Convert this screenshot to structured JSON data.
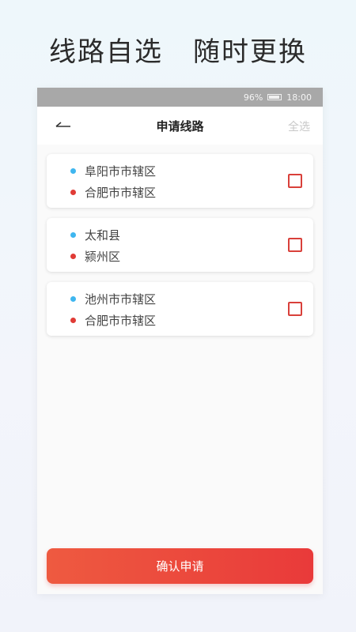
{
  "promo": {
    "part1": "线路自选",
    "part2": "随时更换"
  },
  "statusbar": {
    "battery": "96%",
    "time": "18:00"
  },
  "navbar": {
    "title": "申请线路",
    "select_all": "全选"
  },
  "routes": [
    {
      "from": "阜阳市市辖区",
      "to": "合肥市市辖区",
      "checked": false
    },
    {
      "from": "太和县",
      "to": "颍州区",
      "checked": false
    },
    {
      "from": "池州市市辖区",
      "to": "合肥市市辖区",
      "checked": false
    }
  ],
  "confirm_label": "确认申请",
  "colors": {
    "accent_red": "#e93a3a",
    "origin_dot": "#3fb6ef",
    "destination_dot": "#e03b36"
  }
}
